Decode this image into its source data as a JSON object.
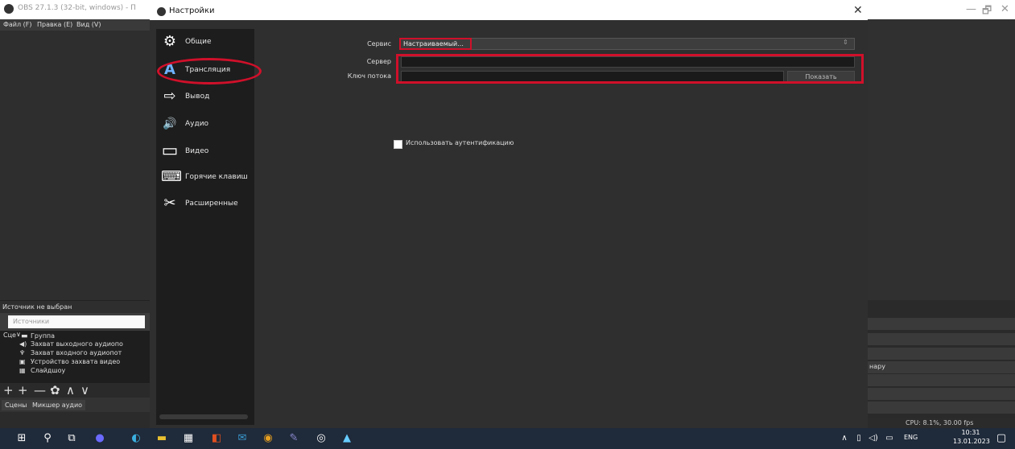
{
  "obs": {
    "title": "OBS 27.1.3 (32-bit, windows) - П",
    "menu": [
      "Файл (F)",
      "Правка (E)",
      "Вид (V)"
    ],
    "no_source": "Источник не выбран",
    "sources_tab": "Источники",
    "scenes_label": "Сце",
    "sources": [
      "Группа",
      "Захват выходного аудиопо",
      "Захват входного аудиопот",
      "Устройство захвата видео",
      "Слайдшоу"
    ],
    "bottom_tabs": [
      "Сцены",
      "Микшер аудио"
    ],
    "status": "CPU: 8.1%, 30.00 fps",
    "right_partial": "нару",
    "win_minimize": "—",
    "win_restore": "🗗",
    "win_close": "✕"
  },
  "settings": {
    "title": "Настройки",
    "close": "✕",
    "sidebar": [
      {
        "label": "Общие",
        "icon": "gear-icon",
        "glyph": "⚙"
      },
      {
        "label": "Трансляция",
        "icon": "broadcast-icon",
        "glyph": "A"
      },
      {
        "label": "Вывод",
        "icon": "output-icon",
        "glyph": "⇨"
      },
      {
        "label": "Аудио",
        "icon": "speaker-icon",
        "glyph": "🔊"
      },
      {
        "label": "Видео",
        "icon": "monitor-icon",
        "glyph": "▭"
      },
      {
        "label": "Горячие клавиш",
        "icon": "keyboard-icon",
        "glyph": "⌨"
      },
      {
        "label": "Расширенные",
        "icon": "tools-icon",
        "glyph": "✂"
      }
    ],
    "form": {
      "service_label": "Сервис",
      "service_value": "Настраиваемый...",
      "server_label": "Сервер",
      "server_value": "",
      "key_label": "Ключ потока",
      "key_value": "",
      "show_button": "Показать",
      "auth_label": "Использовать аутентификацию"
    }
  },
  "taskbar": {
    "lang": "ENG",
    "time": "10:31",
    "date": "13.01.2023"
  },
  "colors": {
    "highlight": "#d0102a"
  }
}
